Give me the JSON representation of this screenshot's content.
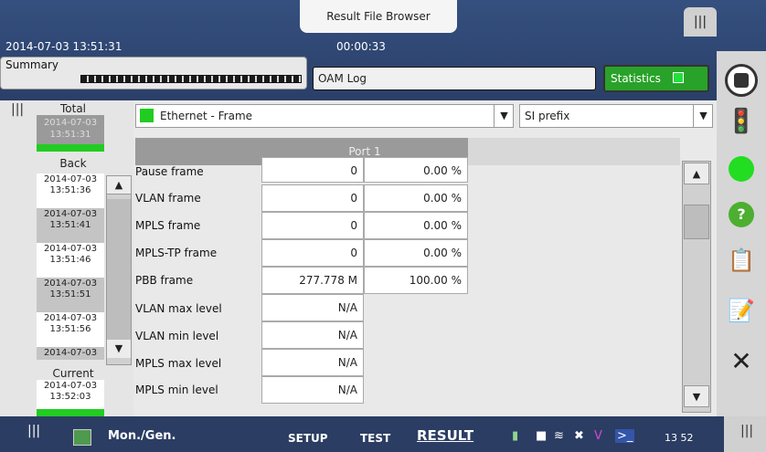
{
  "header": {
    "browser_tab": "Result File Browser",
    "datetime": "2014-07-03 13:51:31",
    "elapsed": "00:00:33",
    "tabs": {
      "summary": "Summary",
      "oam_log": "OAM Log",
      "statistics": "Statistics"
    }
  },
  "left_panel": {
    "total_label": "Total",
    "total_timestamp": "2014-07-03\n13:51:31",
    "back_label": "Back",
    "current_label": "Current",
    "timestamps": [
      {
        "date": "2014-07-03",
        "time": "13:51:36"
      },
      {
        "date": "2014-07-03",
        "time": "13:51:41"
      },
      {
        "date": "2014-07-03",
        "time": "13:51:46"
      },
      {
        "date": "2014-07-03",
        "time": "13:51:51"
      },
      {
        "date": "2014-07-03",
        "time": "13:51:56"
      },
      {
        "date": "2014-07-03",
        "time": ""
      }
    ],
    "current_timestamp": {
      "date": "2014-07-03",
      "time": "13:52:03"
    }
  },
  "main": {
    "frame_select": "Ethernet - Frame",
    "prefix_select": "SI prefix",
    "column_header": "Port 1",
    "rows": [
      {
        "label": "Pause frame",
        "value": "0",
        "percent": "0.00 %"
      },
      {
        "label": "VLAN frame",
        "value": "0",
        "percent": "0.00 %"
      },
      {
        "label": "MPLS frame",
        "value": "0",
        "percent": "0.00 %"
      },
      {
        "label": "MPLS-TP frame",
        "value": "0",
        "percent": "0.00 %"
      },
      {
        "label": "PBB frame",
        "value": "277.778 M",
        "percent": "100.00 %"
      },
      {
        "label": "VLAN max level",
        "value": "N/A",
        "percent": ""
      },
      {
        "label": "VLAN min level",
        "value": "N/A",
        "percent": ""
      },
      {
        "label": "MPLS max level",
        "value": "N/A",
        "percent": ""
      },
      {
        "label": "MPLS min level",
        "value": "N/A",
        "percent": ""
      }
    ]
  },
  "bottom_bar": {
    "mode": "Mon./Gen.",
    "nav": {
      "setup": "SETUP",
      "test": "TEST",
      "result": "RESULT"
    },
    "clock": "13 52"
  },
  "icons": [
    "grip-icon",
    "stop-icon",
    "traffic-light-icon",
    "status-led-icon",
    "help-icon",
    "report-icon",
    "script-icon",
    "close-icon",
    "battery-icon",
    "camera-icon",
    "wifi-icon",
    "bluetooth-icon",
    "vnc-icon",
    "terminal-icon"
  ],
  "colors": {
    "accent_green": "#22cc22",
    "header_blue": "#2c3e63",
    "stats_tab": "#29a229"
  }
}
